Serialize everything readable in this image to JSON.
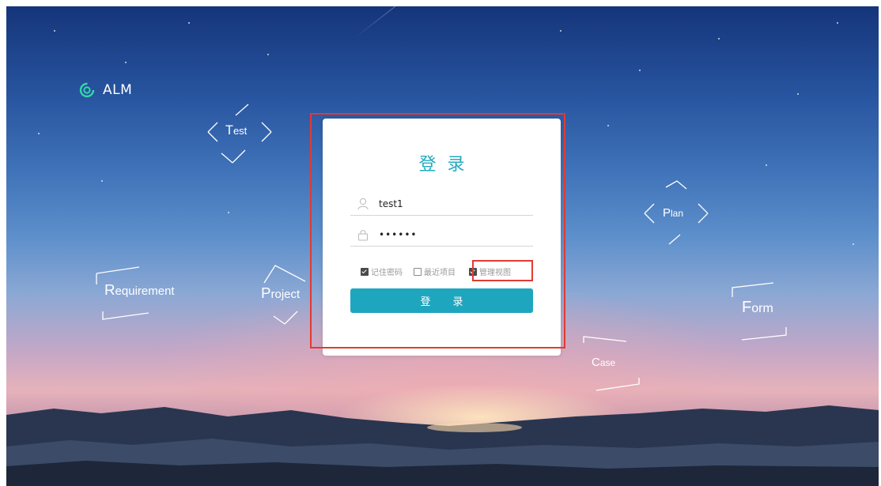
{
  "app": {
    "name": "ALM"
  },
  "floating_tags": {
    "test": {
      "initial": "T",
      "rest": "est"
    },
    "plan": {
      "initial": "P",
      "rest": "lan"
    },
    "requirement": {
      "initial": "R",
      "rest": "equirement"
    },
    "project": {
      "initial": "P",
      "rest": "roject"
    },
    "form": {
      "initial": "F",
      "rest": "orm"
    },
    "case": {
      "initial": "C",
      "rest": "ase"
    }
  },
  "login": {
    "title": "登录",
    "username": {
      "value": "test1",
      "icon": "user-icon"
    },
    "password": {
      "value": "••••••",
      "icon": "lock-icon"
    },
    "options": [
      {
        "label": "记住密码",
        "checked": true
      },
      {
        "label": "最近项目",
        "checked": false
      },
      {
        "label": "管理视图",
        "checked": true
      }
    ],
    "submit_label": "登录"
  },
  "colors": {
    "accent": "#1fa6bf",
    "title": "#25a9c0",
    "highlight": "#e23a33"
  }
}
